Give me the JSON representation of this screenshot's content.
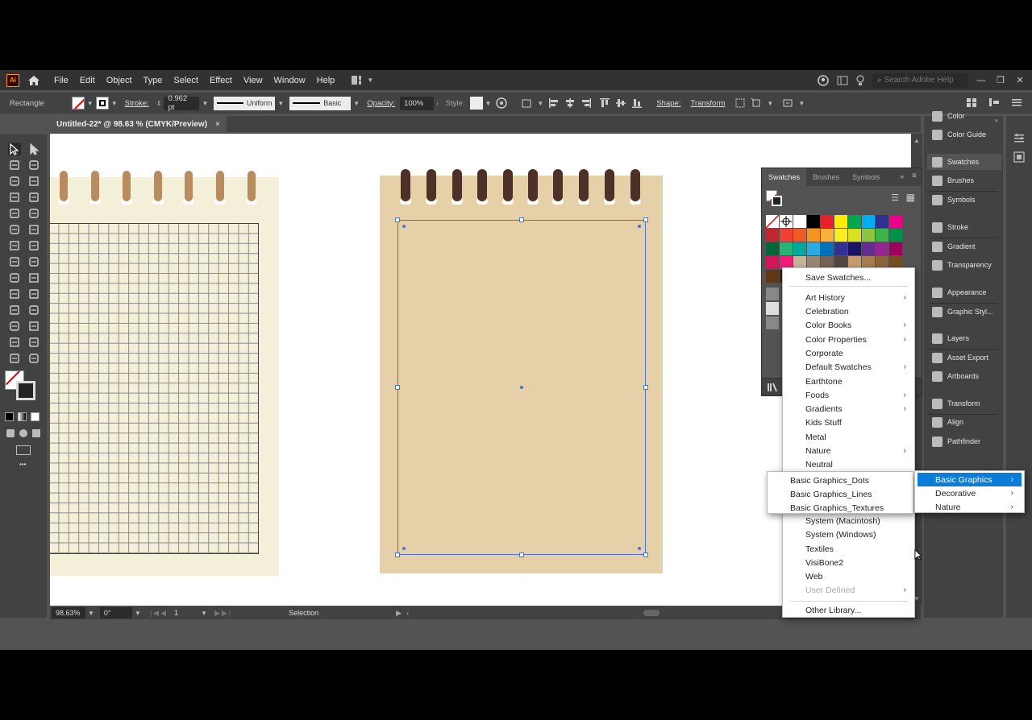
{
  "menubar": {
    "logo": "Ai",
    "items": [
      "File",
      "Edit",
      "Object",
      "Type",
      "Select",
      "Effect",
      "View",
      "Window",
      "Help"
    ],
    "search_placeholder": "Search Adobe Help"
  },
  "controlbar": {
    "tool_name": "Rectangle",
    "stroke_label": "Stroke:",
    "stroke_value": "0.962 pt",
    "profile_label": "Uniform",
    "brush_label": "Basic",
    "opacity_label": "Opacity:",
    "opacity_value": "100%",
    "style_label": "Style:",
    "shape_label": "Shape:",
    "transform_label": "Transform"
  },
  "document": {
    "tab_title": "Untitled-22* @ 98.63 % (CMYK/Preview)",
    "close": "×"
  },
  "statusbar": {
    "zoom": "98.63%",
    "rotation": "0°",
    "artboard": "1",
    "tool": "Selection"
  },
  "dock": {
    "items": [
      "Color",
      "Color Guide",
      "Swatches",
      "Brushes",
      "Symbols",
      "Stroke",
      "Gradient",
      "Transparency",
      "Appearance",
      "Graphic Styl...",
      "Layers",
      "Asset Export",
      "Artboards",
      "Transform",
      "Align",
      "Pathfinder"
    ],
    "active": "Swatches"
  },
  "swatches_panel": {
    "tabs": [
      "Swatches",
      "Brushes",
      "Symbols"
    ],
    "active_tab": "Swatches",
    "colors": [
      "#ffffff",
      "#ffffff",
      "#ffffff",
      "#000000",
      "#e8202a",
      "#ffec00",
      "#00a651",
      "#00aeef",
      "#2e3192",
      "#ec008c",
      "#c1272d",
      "#ef4136",
      "#f15a24",
      "#f7931e",
      "#fbb03b",
      "#fcee21",
      "#d9e021",
      "#8cc63f",
      "#39b54a",
      "#009245",
      "#006837",
      "#22b573",
      "#00a99d",
      "#29abe2",
      "#0071bc",
      "#2e3192",
      "#1b1464",
      "#662d91",
      "#93278f",
      "#9e005d",
      "#d4145a",
      "#ed1e79",
      "#c7b299",
      "#998675",
      "#736357",
      "#534741",
      "#c69c6d",
      "#a67c52",
      "#8c6239",
      "#754c24",
      "#603813",
      "#42210b"
    ]
  },
  "library_menu": {
    "items": [
      {
        "label": "Save Swatches...",
        "sub": false,
        "disabled": false
      },
      {
        "label": "Art History",
        "sub": true,
        "disabled": false
      },
      {
        "label": "Celebration",
        "sub": false,
        "disabled": false
      },
      {
        "label": "Color Books",
        "sub": true,
        "disabled": false
      },
      {
        "label": "Color Properties",
        "sub": true,
        "disabled": false
      },
      {
        "label": "Corporate",
        "sub": false,
        "disabled": false
      },
      {
        "label": "Default Swatches",
        "sub": true,
        "disabled": false
      },
      {
        "label": "Earthtone",
        "sub": false,
        "disabled": false
      },
      {
        "label": "Foods",
        "sub": true,
        "disabled": false
      },
      {
        "label": "Gradients",
        "sub": true,
        "disabled": false
      },
      {
        "label": "Kids Stuff",
        "sub": false,
        "disabled": false
      },
      {
        "label": "Metal",
        "sub": false,
        "disabled": false
      },
      {
        "label": "Nature",
        "sub": true,
        "disabled": false
      },
      {
        "label": "Neutral",
        "sub": false,
        "disabled": false
      },
      {
        "label": "System (Macintosh)",
        "sub": false,
        "disabled": false
      },
      {
        "label": "System (Windows)",
        "sub": false,
        "disabled": false
      },
      {
        "label": "Textiles",
        "sub": false,
        "disabled": false
      },
      {
        "label": "VisiBone2",
        "sub": false,
        "disabled": false
      },
      {
        "label": "Web",
        "sub": false,
        "disabled": false
      },
      {
        "label": "User Defined",
        "sub": true,
        "disabled": true
      },
      {
        "label": "Other Library...",
        "sub": false,
        "disabled": false
      }
    ]
  },
  "patterns_submenu": {
    "items": [
      "Basic Graphics",
      "Decorative",
      "Nature"
    ],
    "highlighted": "Basic Graphics"
  },
  "basic_graphics_submenu": {
    "items": [
      "Basic Graphics_Dots",
      "Basic Graphics_Lines",
      "Basic Graphics_Textures"
    ]
  },
  "colors": {
    "notebook_left_paper": "#f3efd9",
    "notebook_left_rings": "#b98c60",
    "notebook_right_paper": "#e6d0a7",
    "notebook_right_rings": "#4d3128",
    "selection": "#4a73e0",
    "menu_highlight": "#0a7cd9"
  }
}
